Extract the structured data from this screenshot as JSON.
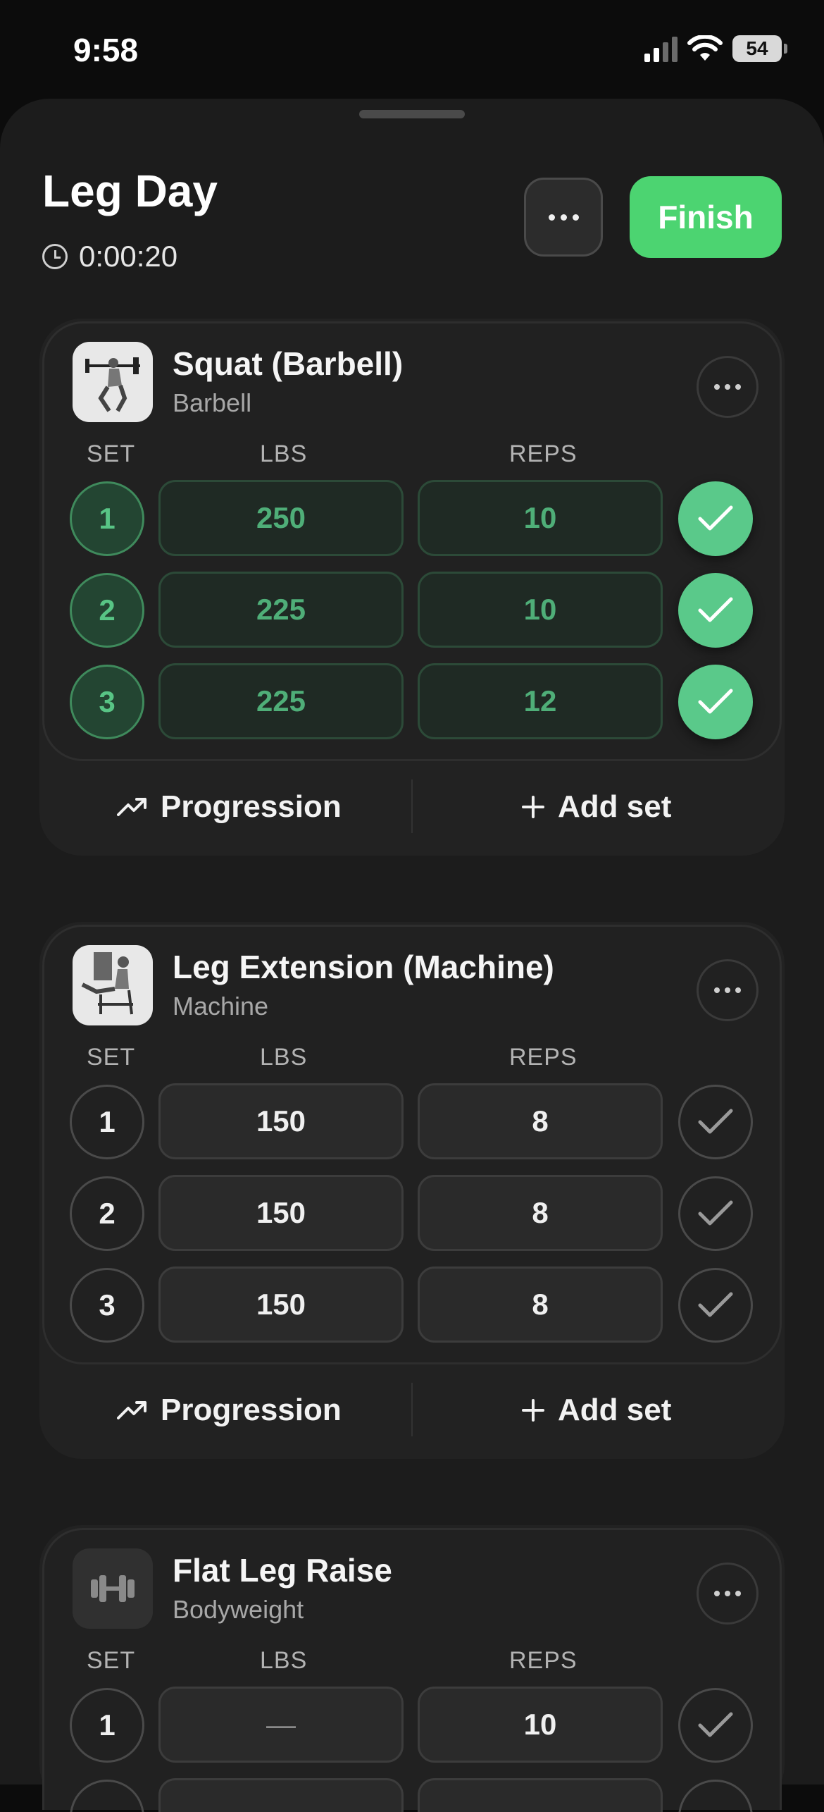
{
  "status": {
    "time": "9:58",
    "battery": "54"
  },
  "workout": {
    "title": "Leg Day",
    "timer": "0:00:20",
    "finish_label": "Finish"
  },
  "labels": {
    "set": "SET",
    "lbs": "LBS",
    "reps": "REPS",
    "progression": "Progression",
    "add_set": "Add set"
  },
  "colors": {
    "accent": "#4cd471",
    "completed": "#5ac98a",
    "background": "#1c1c1c"
  },
  "exercises": [
    {
      "name": "Squat (Barbell)",
      "equipment": "Barbell",
      "thumb_icon": "squat-illustration",
      "sets": [
        {
          "set": "1",
          "lbs": "250",
          "reps": "10",
          "completed": true
        },
        {
          "set": "2",
          "lbs": "225",
          "reps": "10",
          "completed": true
        },
        {
          "set": "3",
          "lbs": "225",
          "reps": "12",
          "completed": true
        }
      ]
    },
    {
      "name": "Leg Extension (Machine)",
      "equipment": "Machine",
      "thumb_icon": "leg-extension-illustration",
      "sets": [
        {
          "set": "1",
          "lbs": "150",
          "reps": "8",
          "completed": false
        },
        {
          "set": "2",
          "lbs": "150",
          "reps": "8",
          "completed": false
        },
        {
          "set": "3",
          "lbs": "150",
          "reps": "8",
          "completed": false
        }
      ]
    },
    {
      "name": "Flat Leg Raise",
      "equipment": "Bodyweight",
      "thumb_icon": "dumbbell-icon",
      "sets": [
        {
          "set": "1",
          "lbs": "—",
          "reps": "10",
          "completed": false
        }
      ]
    }
  ]
}
